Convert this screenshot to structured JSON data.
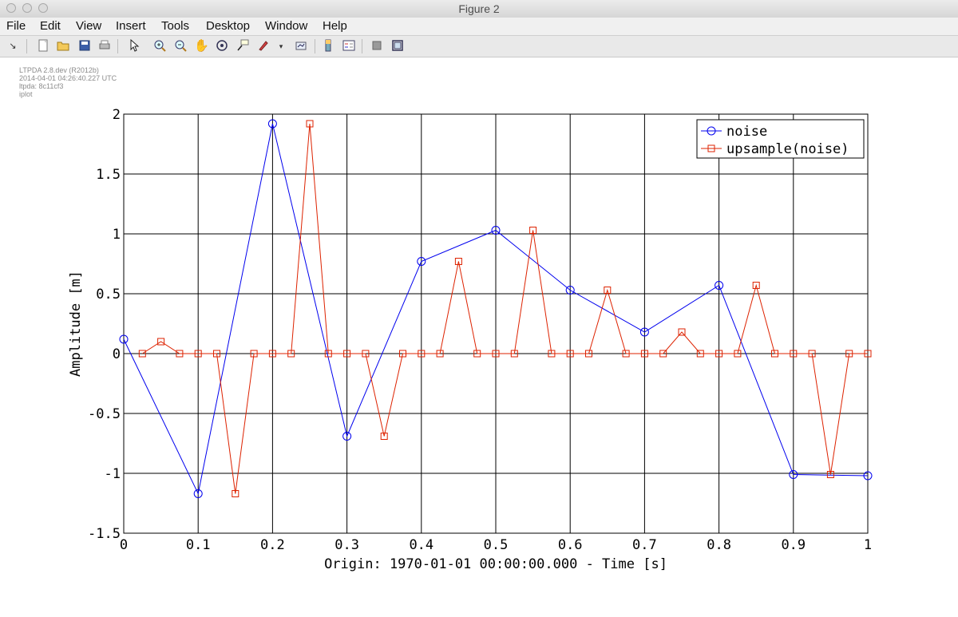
{
  "window": {
    "title": "Figure 2"
  },
  "menu": [
    "File",
    "Edit",
    "View",
    "Insert",
    "Tools",
    "Desktop",
    "Window",
    "Help"
  ],
  "metadata": [
    "LTPDA 2.8.dev (R2012b)",
    "2014-04-01 04:26:40.227 UTC",
    "ltpda: 8c11cf3",
    "iplot"
  ],
  "chart_data": {
    "type": "line",
    "xlabel": "Origin: 1970-01-01 00:00:00.000 - Time  [s]",
    "ylabel": "Amplitude  [m]",
    "xlim": [
      0,
      1
    ],
    "ylim": [
      -1.5,
      2
    ],
    "xticks": [
      "0",
      "0.1",
      "0.2",
      "0.3",
      "0.4",
      "0.5",
      "0.6",
      "0.7",
      "0.8",
      "0.9",
      "1"
    ],
    "yticks": [
      "2",
      "1.5",
      "1",
      "0.5",
      "0",
      "-0.5",
      "-1",
      "-1.5"
    ],
    "grid": true,
    "legend_position": "top-right",
    "series": [
      {
        "name": "noise",
        "color": "#0000ee",
        "marker": "circle",
        "x": [
          0,
          0.1,
          0.2,
          0.3,
          0.4,
          0.5,
          0.6,
          0.7,
          0.8,
          0.9,
          1.0
        ],
        "y": [
          0.12,
          -1.17,
          1.92,
          -0.69,
          0.77,
          1.03,
          0.53,
          0.18,
          0.57,
          -1.01,
          -1.02
        ]
      },
      {
        "name": "upsample(noise)",
        "color": "#dd2200",
        "marker": "square",
        "x": [
          0.025,
          0.05,
          0.075,
          0.1,
          0.125,
          0.15,
          0.175,
          0.2,
          0.225,
          0.25,
          0.275,
          0.3,
          0.325,
          0.35,
          0.375,
          0.4,
          0.425,
          0.45,
          0.475,
          0.5,
          0.525,
          0.55,
          0.575,
          0.6,
          0.625,
          0.65,
          0.675,
          0.7,
          0.725,
          0.75,
          0.775,
          0.8,
          0.825,
          0.85,
          0.875,
          0.9,
          0.925,
          0.95,
          0.975,
          1.0
        ],
        "y": [
          0,
          0.1,
          0,
          0,
          0,
          -1.17,
          0,
          0,
          0,
          1.92,
          0,
          0,
          0,
          -0.69,
          0,
          0,
          0,
          0.77,
          0,
          0,
          0,
          1.03,
          0,
          0,
          0,
          0.53,
          0,
          0,
          0,
          0.18,
          0,
          0,
          0,
          0.57,
          0,
          0,
          0,
          -1.01,
          0,
          0
        ]
      }
    ]
  }
}
